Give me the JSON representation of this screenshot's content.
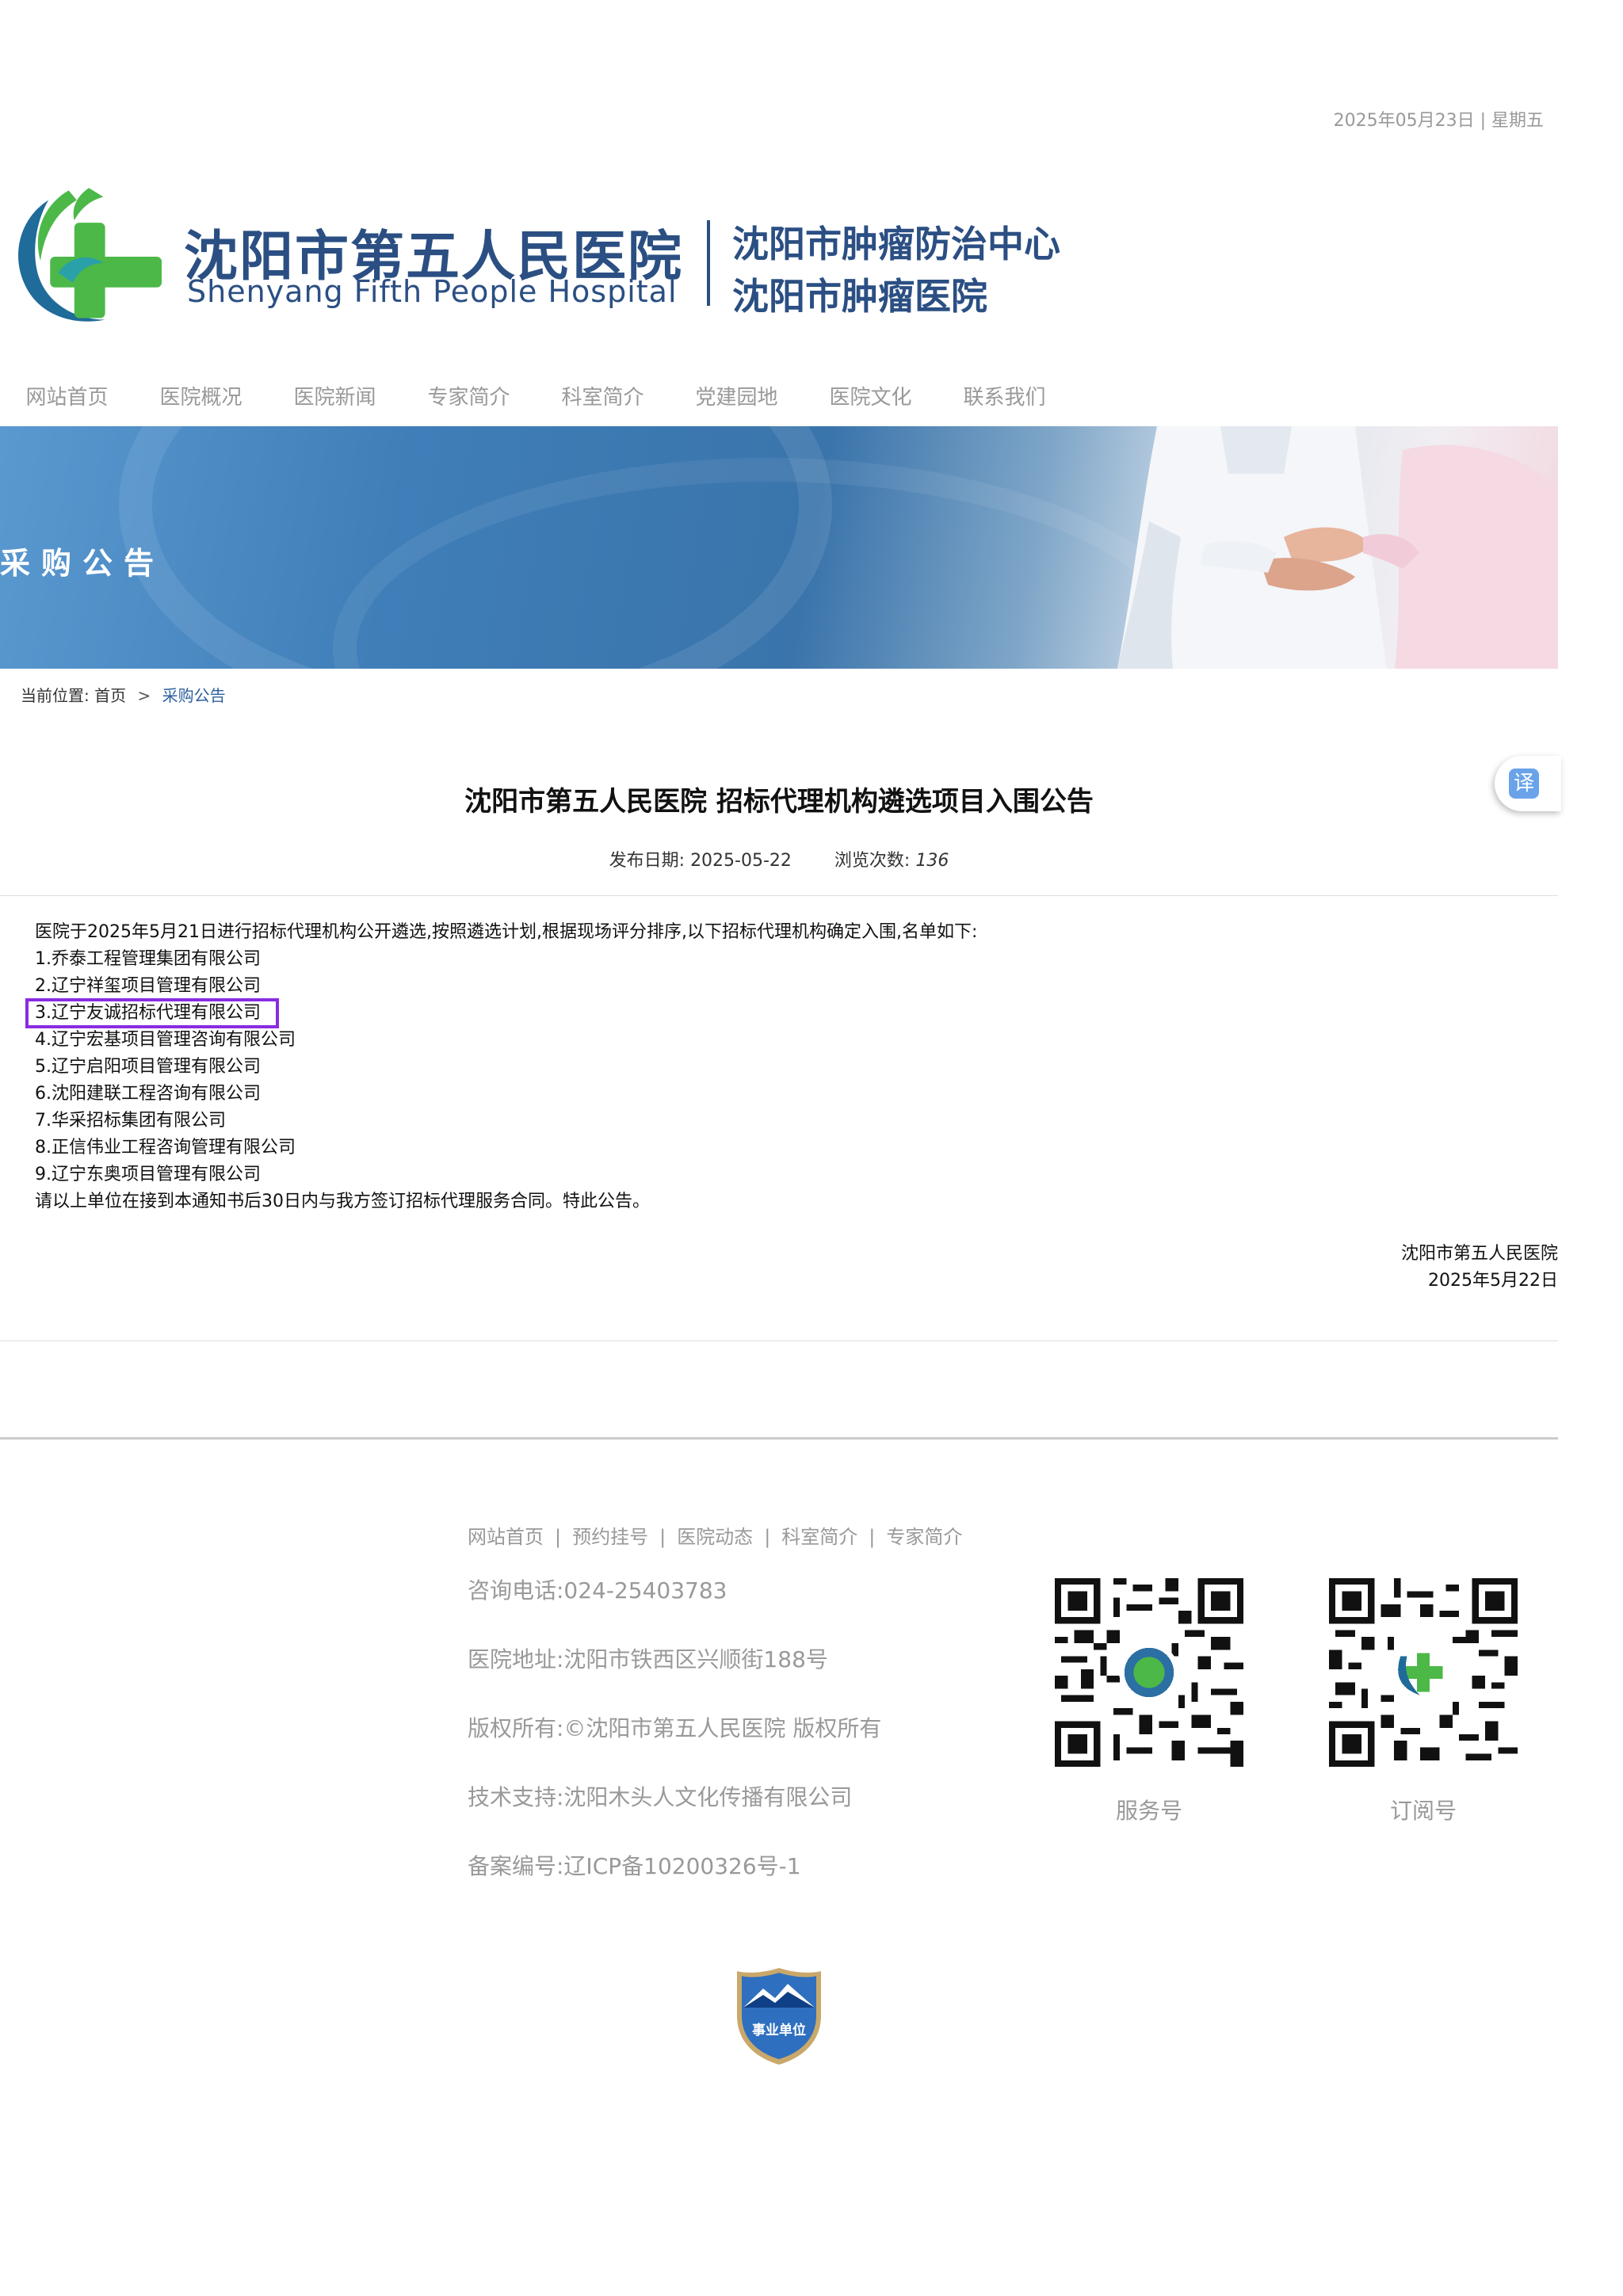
{
  "top_bar": {
    "date": "2025年05月23日 | 星期五"
  },
  "header": {
    "hospital_name_cn": "沈阳市第五人民医院",
    "hospital_name_en": "Shenyang Fifth People Hospital",
    "center_name_1": "沈阳市肿瘤防治中心",
    "center_name_2": "沈阳市肿瘤医院"
  },
  "nav": {
    "items": [
      {
        "label": "网站首页"
      },
      {
        "label": "医院概况"
      },
      {
        "label": "医院新闻"
      },
      {
        "label": "专家简介"
      },
      {
        "label": "科室简介"
      },
      {
        "label": "党建园地"
      },
      {
        "label": "医院文化"
      },
      {
        "label": "联系我们"
      }
    ]
  },
  "banner": {
    "title": "采购公告"
  },
  "breadcrumb": {
    "prefix": "当前位置:",
    "home": "首页",
    "separator": ">",
    "current": "采购公告"
  },
  "translate_widget": {
    "label": "译"
  },
  "article": {
    "title": "沈阳市第五人民医院 招标代理机构遴选项目入围公告",
    "publish_label": "发布日期:",
    "publish_date": "2025-05-22",
    "views_label": "浏览次数:",
    "views": "136",
    "intro": "医院于2025年5月21日进行招标代理机构公开遴选,按照遴选计划,根据现场评分排序,以下招标代理机构确定入围,名单如下:",
    "companies": [
      "1.乔泰工程管理集团有限公司",
      "2.辽宁祥玺项目管理有限公司",
      "3.辽宁友诚招标代理有限公司",
      "4.辽宁宏基项目管理咨询有限公司",
      "5.辽宁启阳项目管理有限公司",
      "6.沈阳建联工程咨询有限公司",
      "7.华采招标集团有限公司",
      "8.正信伟业工程咨询管理有限公司",
      "9.辽宁东奥项目管理有限公司"
    ],
    "closing": "请以上单位在接到本通知书后30日内与我方签订招标代理服务合同。特此公告。",
    "signature_org": "沈阳市第五人民医院",
    "signature_date": "2025年5月22日"
  },
  "footer": {
    "links": [
      "网站首页",
      "预约挂号",
      "医院动态",
      "科室简介",
      "专家简介"
    ],
    "link_separator": "|",
    "phone": "咨询电话:024-25403783",
    "address": "医院地址:沈阳市铁西区兴顺街188号",
    "copyright": "版权所有:©沈阳市第五人民医院 版权所有",
    "tech_support": "技术支持:沈阳木头人文化传播有限公司",
    "icp": "备案编号:辽ICP备10200326号-1",
    "qr_service_label": "服务号",
    "qr_subscribe_label": "订阅号",
    "badge_text": "事业单位"
  },
  "colors": {
    "brand_blue": "#2b4f83",
    "brand_green": "#4cb848",
    "nav_text": "#999999",
    "highlight_box": "#8a2be2",
    "link_blue": "#2b5f9e"
  },
  "icons": {
    "logo": "hospital-cross-logo-icon",
    "translate": "translate-icon",
    "qr_service": "qr-code-icon",
    "qr_subscribe": "qr-code-icon",
    "gov_badge": "shield-badge-icon"
  }
}
